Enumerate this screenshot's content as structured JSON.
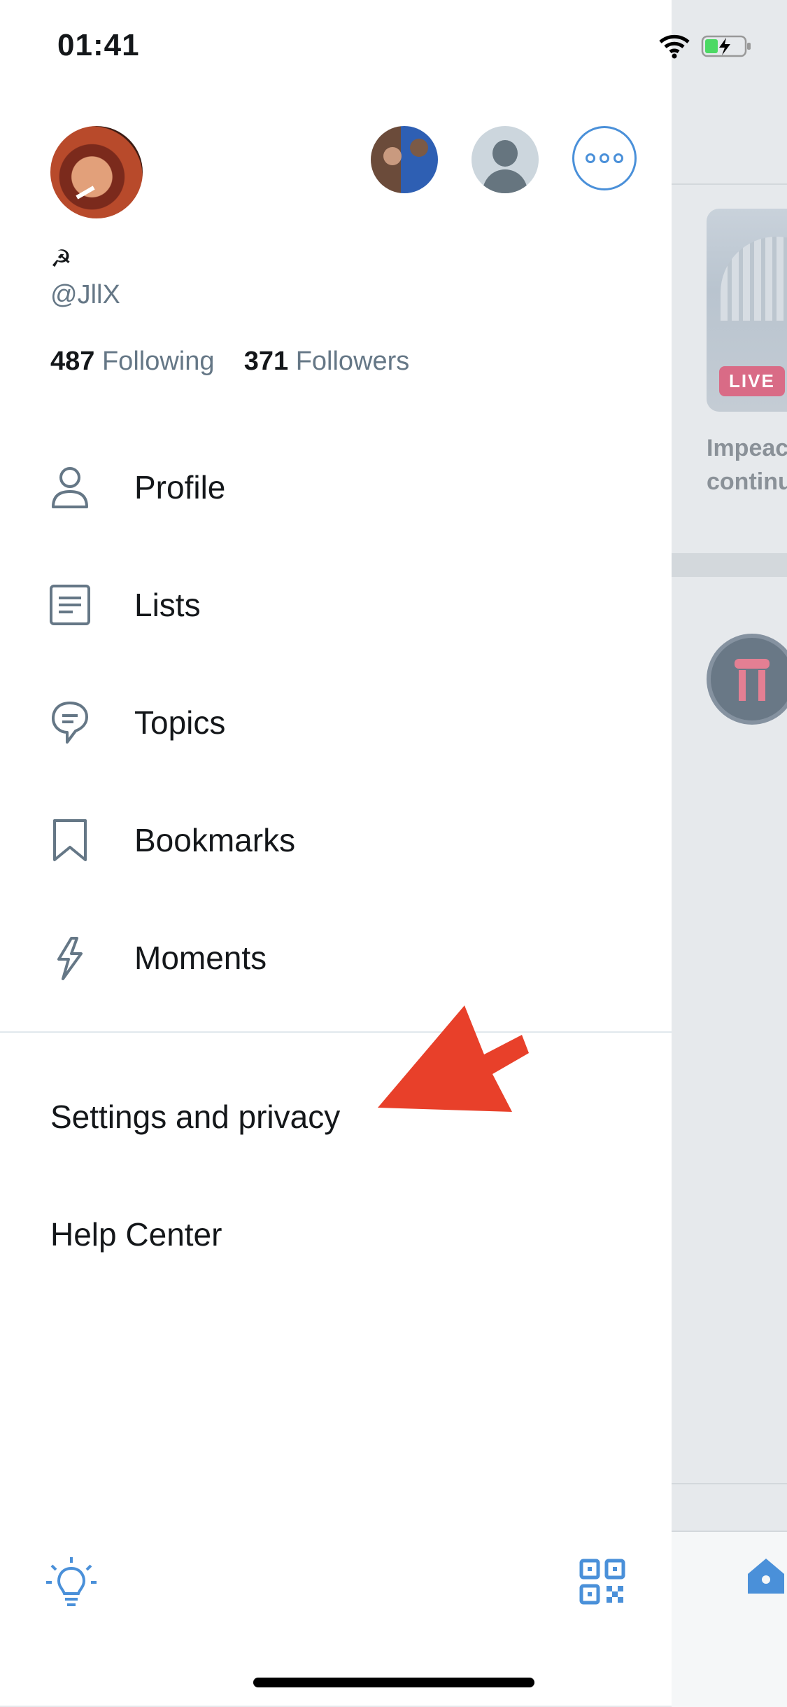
{
  "status_bar": {
    "time": "01:41"
  },
  "profile": {
    "name": "☭",
    "handle": "@JllX",
    "following_count": "487",
    "following_label": "Following",
    "followers_count": "371",
    "followers_label": "Followers"
  },
  "menu": {
    "items": [
      {
        "label": "Profile",
        "icon": "person-icon"
      },
      {
        "label": "Lists",
        "icon": "list-icon"
      },
      {
        "label": "Topics",
        "icon": "topic-bubble-icon"
      },
      {
        "label": "Bookmarks",
        "icon": "bookmark-icon"
      },
      {
        "label": "Moments",
        "icon": "lightning-icon"
      }
    ]
  },
  "links": {
    "settings": "Settings and privacy",
    "help": "Help Center"
  },
  "background": {
    "live_badge": "LIVE",
    "headline_line1": "Impeac",
    "headline_line2": "continu"
  },
  "colors": {
    "accent": "#4a90d9",
    "annotation_arrow": "#e8402a",
    "secondary_text": "#657786",
    "icon_gray": "#657786"
  }
}
